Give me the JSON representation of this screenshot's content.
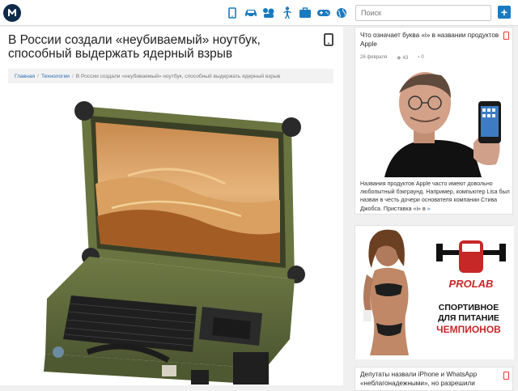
{
  "header": {
    "search_placeholder": "Поиск",
    "nav_icons": [
      "tablet-icon",
      "car-icon",
      "child-icon",
      "person-icon",
      "suitcase-icon",
      "gamepad-icon",
      "globe-icon"
    ],
    "add_icon": "plus-icon",
    "accent": "#1a7ac0"
  },
  "article": {
    "title": "В России создали «неубиваемый» ноутбук, способный выдержать ядерный взрыв",
    "breadcrumb": {
      "home": "Главная",
      "section": "Технологии",
      "current": "В России создали «неубиваемый» ноутбук, способный выдержать ядерный взрыв"
    }
  },
  "sidebar": {
    "card1": {
      "title": "Что означает буква «i» в названии продуктов Apple",
      "date": "26 февраля",
      "views": "43",
      "comments": "0",
      "text": "Названия продуктов Apple часто имеют довольно любопытный бэкграунд. Например, компьютер Lisa был назван в честь дочери основателя компании Стива Джобса. Приставка «i» в",
      "more": "»"
    },
    "ad": {
      "brand": "PROLAB",
      "line1": "СПОРТИВНОЕ",
      "line2": "ДЛЯ ПИТАНИЕ",
      "line3": "ЧЕМПИОНОВ"
    },
    "card3": {
      "title": "Депутаты назвали iPhone и WhatsApp «неблагонадежными», но разрешили"
    }
  }
}
